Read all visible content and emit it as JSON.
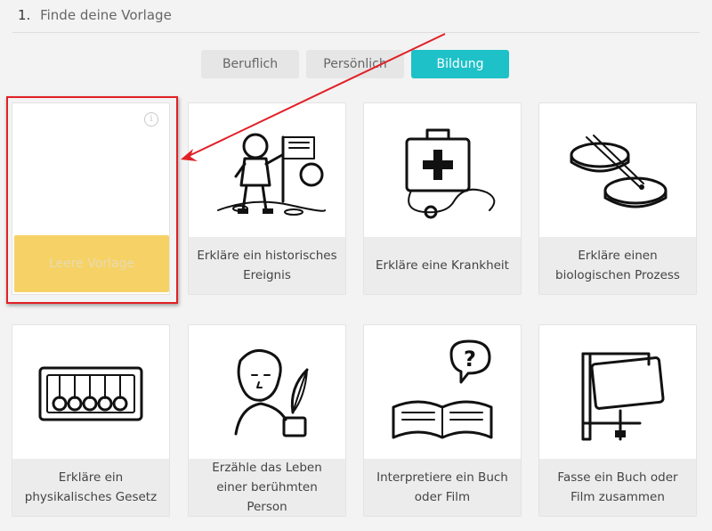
{
  "step": {
    "number": "1.",
    "title": "Finde deine Vorlage"
  },
  "tabs": [
    {
      "label": "Beruflich",
      "active": false
    },
    {
      "label": "Persönlich",
      "active": false
    },
    {
      "label": "Bildung",
      "active": true
    }
  ],
  "templates": [
    {
      "label": "Leere Vorlage",
      "icon": "blank-icon"
    },
    {
      "label": "Erkläre ein historisches Ereignis",
      "icon": "astronaut-moon-icon"
    },
    {
      "label": "Erkläre eine Krankheit",
      "icon": "medical-kit-stethoscope-icon"
    },
    {
      "label": "Erkläre einen biologischen Prozess",
      "icon": "petri-dish-icon"
    },
    {
      "label": "Erkläre ein physikalisches Gesetz",
      "icon": "newtons-cradle-icon"
    },
    {
      "label": "Erzähle das Leben einer berühmten Person",
      "icon": "portrait-quill-icon"
    },
    {
      "label": "Interpretiere ein Buch oder Film",
      "icon": "book-question-icon"
    },
    {
      "label": "Fasse ein Buch oder Film zusammen",
      "icon": "book-clamp-icon"
    }
  ],
  "colors": {
    "accent": "#1ec1c8",
    "blank_label_bg": "#f6d266",
    "highlight": "#e12026"
  }
}
